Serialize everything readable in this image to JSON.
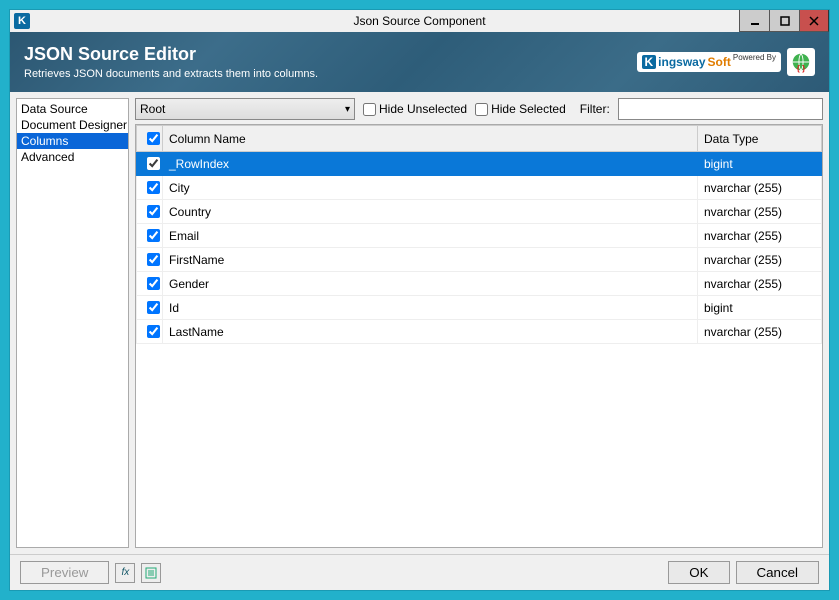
{
  "window": {
    "title": "Json Source Component",
    "icon_letter": "K"
  },
  "header": {
    "title": "JSON Source Editor",
    "subtitle": "Retrieves JSON documents and extracts them into columns.",
    "brand_powered": "Powered By",
    "brand_name_k": "K",
    "brand_name_rest1": "ingsway",
    "brand_name_rest2": "Soft"
  },
  "sidebar": {
    "items": [
      "Data Source",
      "Document Designer",
      "Columns",
      "Advanced"
    ],
    "selected_index": 2
  },
  "toolbar": {
    "root_selected": "Root",
    "hide_unselected_label": "Hide Unselected",
    "hide_unselected": false,
    "hide_selected_label": "Hide Selected",
    "hide_selected": false,
    "filter_label": "Filter:",
    "filter_value": ""
  },
  "grid": {
    "header_check": true,
    "col1": "Column Name",
    "col2": "Data Type",
    "rows": [
      {
        "checked": true,
        "name": "_RowIndex",
        "type": "bigint",
        "selected": true
      },
      {
        "checked": true,
        "name": "City",
        "type": "nvarchar (255)",
        "selected": false
      },
      {
        "checked": true,
        "name": "Country",
        "type": "nvarchar (255)",
        "selected": false
      },
      {
        "checked": true,
        "name": "Email",
        "type": "nvarchar (255)",
        "selected": false
      },
      {
        "checked": true,
        "name": "FirstName",
        "type": "nvarchar (255)",
        "selected": false
      },
      {
        "checked": true,
        "name": "Gender",
        "type": "nvarchar (255)",
        "selected": false
      },
      {
        "checked": true,
        "name": "Id",
        "type": "bigint",
        "selected": false
      },
      {
        "checked": true,
        "name": "LastName",
        "type": "nvarchar (255)",
        "selected": false
      }
    ]
  },
  "footer": {
    "preview": "Preview",
    "fx_label": "fx",
    "ok": "OK",
    "cancel": "Cancel"
  }
}
